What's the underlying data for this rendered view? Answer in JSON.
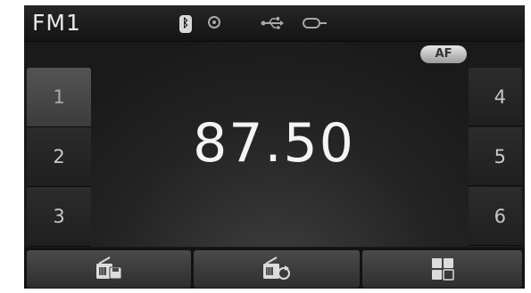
{
  "status_bar": {
    "band": "FM1",
    "bluetooth_glyph": "ᛒ",
    "icons": [
      "bluetooth-icon",
      "disc-icon",
      "usb-icon",
      "aux-icon"
    ]
  },
  "tuner": {
    "frequency": "87.50",
    "af_label": "AF"
  },
  "presets": {
    "left": [
      "1",
      "2",
      "3"
    ],
    "right": [
      "4",
      "5",
      "6"
    ],
    "selected": "1"
  },
  "bottom_bar": {
    "buttons": [
      "radio-save-icon",
      "radio-scan-icon",
      "menu-grid-icon"
    ]
  },
  "colors": {
    "background": "#1a1a1a",
    "text": "#f4f4f4",
    "selected_preset": "#4a4a4a"
  }
}
